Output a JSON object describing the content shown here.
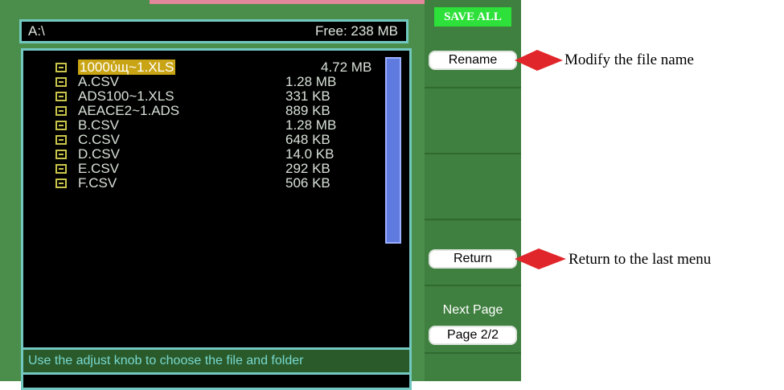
{
  "header": {
    "path": "A:\\",
    "free": "Free: 238 MB"
  },
  "files": [
    {
      "name": "1000ύщ~1.XLS",
      "size": "4.72 MB",
      "selected": true
    },
    {
      "name": "A.CSV",
      "size": "1.28 MB"
    },
    {
      "name": "ADS100~1.XLS",
      "size": "331 KB"
    },
    {
      "name": "AEACE2~1.ADS",
      "size": "889 KB"
    },
    {
      "name": "B.CSV",
      "size": "1.28 MB"
    },
    {
      "name": "C.CSV",
      "size": "648 KB"
    },
    {
      "name": "D.CSV",
      "size": "14.0 KB"
    },
    {
      "name": "E.CSV",
      "size": "292 KB"
    },
    {
      "name": "F.CSV",
      "size": "506 KB"
    }
  ],
  "hint": "Use the adjust knob to choose the file and folder",
  "menu": {
    "title": "SAVE ALL",
    "rename": "Rename",
    "return": "Return",
    "next_page": "Next Page",
    "page": "Page 2/2"
  },
  "annotations": {
    "rename_note": "Modify the file name",
    "return_note": "Return to the last menu"
  },
  "colors": {
    "accent_green": "#2ee03a",
    "highlight": "#c9a415",
    "arrow_red": "#e0262a"
  }
}
